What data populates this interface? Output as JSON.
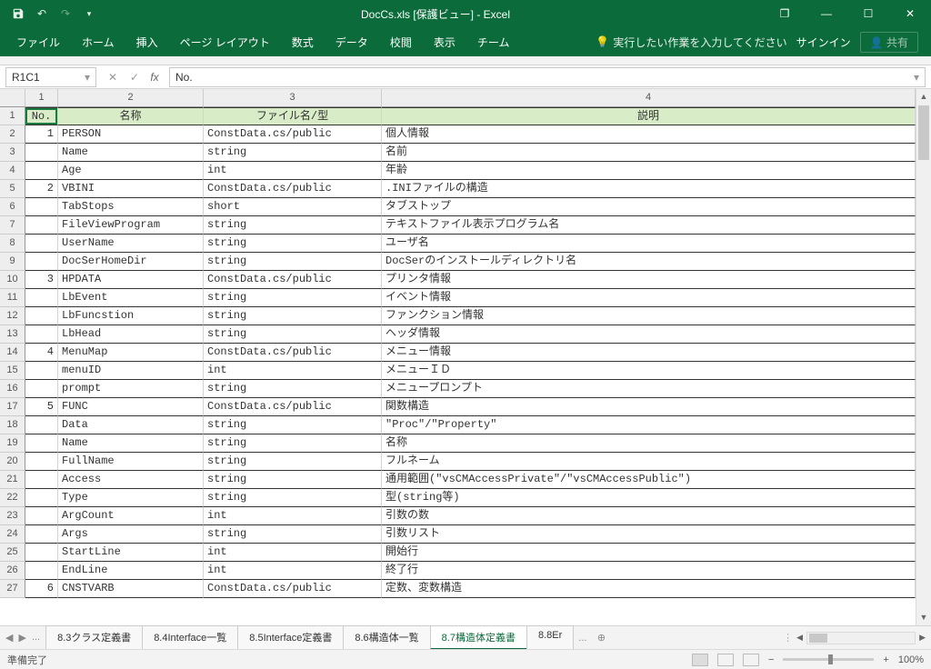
{
  "title": "DocCs.xls  [保護ビュー] - Excel",
  "qat": {
    "save": "save",
    "undo": "undo",
    "redo": "redo"
  },
  "window": {
    "restore": "❐",
    "minimize": "—",
    "maximize": "☐",
    "close": "✕"
  },
  "ribbon": {
    "tabs": [
      "ファイル",
      "ホーム",
      "挿入",
      "ページ レイアウト",
      "数式",
      "データ",
      "校閲",
      "表示",
      "チーム"
    ],
    "tellme": "実行したい作業を入力してください",
    "signin": "サインイン",
    "share": "共有"
  },
  "namebox": "R1C1",
  "formula": "No.",
  "col_headers": [
    "1",
    "2",
    "3",
    "4"
  ],
  "header_cells": [
    "No.",
    "名称",
    "ファイル名/型",
    "説明"
  ],
  "rows": [
    {
      "n": "1",
      "no": "1",
      "name": "PERSON",
      "type": "ConstData.cs/public",
      "desc": "個人情報"
    },
    {
      "n": "2",
      "no": "",
      "name": "Name",
      "type": "string",
      "desc": "名前"
    },
    {
      "n": "3",
      "no": "",
      "name": "Age",
      "type": "int",
      "desc": "年齢"
    },
    {
      "n": "4",
      "no": "2",
      "name": "VBINI",
      "type": "ConstData.cs/public",
      "desc": ".INIファイルの構造"
    },
    {
      "n": "5",
      "no": "",
      "name": "TabStops",
      "type": "short",
      "desc": "タブストップ"
    },
    {
      "n": "6",
      "no": "",
      "name": "FileViewProgram",
      "type": "string",
      "desc": "テキストファイル表示プログラム名"
    },
    {
      "n": "7",
      "no": "",
      "name": "UserName",
      "type": "string",
      "desc": "ユーザ名"
    },
    {
      "n": "8",
      "no": "",
      "name": "DocSerHomeDir",
      "type": "string",
      "desc": "DocSerのインストールディレクトリ名"
    },
    {
      "n": "9",
      "no": "3",
      "name": "HPDATA",
      "type": "ConstData.cs/public",
      "desc": "プリンタ情報"
    },
    {
      "n": "10",
      "no": "",
      "name": "LbEvent",
      "type": "string",
      "desc": "イベント情報"
    },
    {
      "n": "11",
      "no": "",
      "name": "LbFuncstion",
      "type": "string",
      "desc": "ファンクション情報"
    },
    {
      "n": "12",
      "no": "",
      "name": "LbHead",
      "type": "string",
      "desc": "ヘッダ情報"
    },
    {
      "n": "13",
      "no": "4",
      "name": "MenuMap",
      "type": "ConstData.cs/public",
      "desc": "メニュー情報"
    },
    {
      "n": "14",
      "no": "",
      "name": "menuID",
      "type": "int",
      "desc": "メニューＩＤ"
    },
    {
      "n": "15",
      "no": "",
      "name": "prompt",
      "type": "string",
      "desc": "メニュープロンプト"
    },
    {
      "n": "16",
      "no": "5",
      "name": "FUNC",
      "type": "ConstData.cs/public",
      "desc": "関数構造"
    },
    {
      "n": "17",
      "no": "",
      "name": "Data",
      "type": "string",
      "desc": "\"Proc\"/\"Property\""
    },
    {
      "n": "18",
      "no": "",
      "name": "Name",
      "type": "string",
      "desc": "名称"
    },
    {
      "n": "19",
      "no": "",
      "name": "FullName",
      "type": "string",
      "desc": "フルネーム"
    },
    {
      "n": "20",
      "no": "",
      "name": "Access",
      "type": "string",
      "desc": "通用範囲(\"vsCMAccessPrivate\"/\"vsCMAccessPublic\")"
    },
    {
      "n": "21",
      "no": "",
      "name": "Type",
      "type": "string",
      "desc": "型(string等)"
    },
    {
      "n": "22",
      "no": "",
      "name": "ArgCount",
      "type": "int",
      "desc": "引数の数"
    },
    {
      "n": "23",
      "no": "",
      "name": "Args",
      "type": "string",
      "desc": "引数リスト"
    },
    {
      "n": "24",
      "no": "",
      "name": "StartLine",
      "type": "int",
      "desc": "開始行"
    },
    {
      "n": "25",
      "no": "",
      "name": "EndLine",
      "type": "int",
      "desc": "終了行"
    },
    {
      "n": "26",
      "no": "6",
      "name": "CNSTVARB",
      "type": "ConstData.cs/public",
      "desc": "定数、変数構造"
    }
  ],
  "sheets": {
    "prev_overflow": "...",
    "tabs": [
      "8.3クラス定義書",
      "8.4Interface一覧",
      "8.5Interface定義書",
      "8.6構造体一覧",
      "8.7構造体定義書",
      "8.8Er"
    ],
    "active_index": 4,
    "next_overflow": "..."
  },
  "status": {
    "ready": "準備完了",
    "zoom": "100%"
  }
}
